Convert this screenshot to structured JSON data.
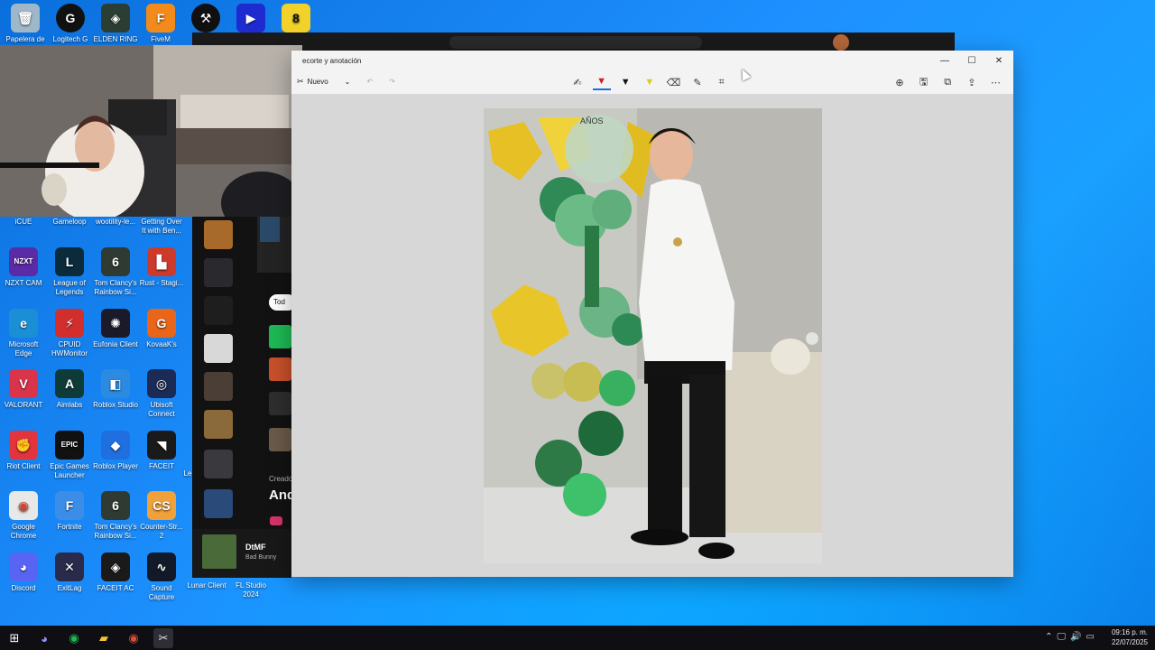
{
  "desktop": {
    "icons_top": [
      {
        "label": "Papelera de",
        "color": "#9fb8c9",
        "glyph": "🗑"
      },
      {
        "label": "Logitech G",
        "color": "#111111",
        "glyph": "G"
      },
      {
        "label": "ELDEN RING",
        "color": "#2a3e33",
        "glyph": "◈"
      },
      {
        "label": "FiveM",
        "color": "#f28a1c",
        "glyph": "F"
      },
      {
        "label": "",
        "color": "#101010",
        "glyph": "⚒"
      },
      {
        "label": "",
        "color": "#1d2bd1",
        "glyph": "▶"
      },
      {
        "label": "",
        "color": "#f2d22a",
        "glyph": "8"
      }
    ],
    "icons_col_labels_row1": [
      {
        "label": "iCUE"
      },
      {
        "label": "Gameloop"
      },
      {
        "label": "wootility-le..."
      },
      {
        "label": "Getting Over It with Ben..."
      }
    ],
    "grid": [
      {
        "label": "NZXT CAM",
        "color": "#5b2aa6",
        "glyph": "NZXT"
      },
      {
        "label": "League of Legends",
        "color": "#0b2a3a",
        "glyph": "L"
      },
      {
        "label": "Tom Clancy's Rainbow Si...",
        "color": "#2f3a33",
        "glyph": "6"
      },
      {
        "label": "Rust - Stagi...",
        "color": "#cd3a2b",
        "glyph": "▙"
      },
      {
        "label": "Microsoft Edge",
        "color": "#1b8fd6",
        "glyph": "e"
      },
      {
        "label": "CPUID HWMonitor",
        "color": "#d12e2e",
        "glyph": "⚡"
      },
      {
        "label": "Eufonia Client",
        "color": "#1a1a2a",
        "glyph": "✺"
      },
      {
        "label": "KovaaK's",
        "color": "#e8651a",
        "glyph": "G"
      },
      {
        "label": "VALORANT",
        "color": "#d9344a",
        "glyph": "V"
      },
      {
        "label": "Aimlabs",
        "color": "#0e3a38",
        "glyph": "A"
      },
      {
        "label": "Roblox Studio",
        "color": "#2a8be0",
        "glyph": "◧"
      },
      {
        "label": "Ubisoft Connect",
        "color": "#1c2a56",
        "glyph": "◎"
      },
      {
        "label": "Riot Client",
        "color": "#e2343f",
        "glyph": "✊"
      },
      {
        "label": "Epic Games Launcher",
        "color": "#111111",
        "glyph": "EPIC"
      },
      {
        "label": "Roblox Player",
        "color": "#1f6fe0",
        "glyph": "◆"
      },
      {
        "label": "FACEIT",
        "color": "#1a1a1a",
        "glyph": "◥"
      },
      {
        "label": "Google Chrome",
        "color": "#e8e8e8",
        "glyph": "◉"
      },
      {
        "label": "Fortnite",
        "color": "#3b8de8",
        "glyph": "F"
      },
      {
        "label": "Tom Clancy's Rainbow Si...",
        "color": "#2f3a33",
        "glyph": "6"
      },
      {
        "label": "Counter-Str... 2",
        "color": "#f0a13a",
        "glyph": "CS"
      },
      {
        "label": "Discord",
        "color": "#5865f2",
        "glyph": "◕"
      },
      {
        "label": "ExitLag",
        "color": "#2a2a4a",
        "glyph": "✕"
      },
      {
        "label": "FACEIT AC",
        "color": "#1a1a1a",
        "glyph": "◈"
      },
      {
        "label": "Sound Capture",
        "color": "#121a2a",
        "glyph": "∿"
      }
    ],
    "extra_labels": {
      "lunar": "Lunar Client",
      "flstudio": "FL Studio 2024",
      "le": "Le"
    }
  },
  "spotify": {
    "tab_label": "Tod",
    "created_by": "Creado",
    "artist_partial": "And",
    "now_playing": {
      "title": "DtMF",
      "artist": "Bad Bunny"
    }
  },
  "editor": {
    "title": "ecorte y anotación",
    "new_label": "Nuevo",
    "controls": {
      "minimize": "—",
      "maximize": "☐",
      "close": "✕"
    },
    "tools": [
      {
        "name": "touch-write-icon",
        "glyph": "✍"
      },
      {
        "name": "red-pen-icon",
        "glyph": "▼",
        "color": "#d21f1f",
        "active": true
      },
      {
        "name": "black-pen-icon",
        "glyph": "▼",
        "color": "#111111"
      },
      {
        "name": "highlighter-icon",
        "glyph": "▼",
        "color": "#d8cf1e"
      },
      {
        "name": "eraser-icon",
        "glyph": "⌫"
      },
      {
        "name": "ruler-icon",
        "glyph": "✎"
      },
      {
        "name": "crop-icon",
        "glyph": "⌗"
      }
    ],
    "right_tools": [
      {
        "name": "zoom-icon",
        "glyph": "⊕"
      },
      {
        "name": "save-icon",
        "glyph": "🖫"
      },
      {
        "name": "copy-icon",
        "glyph": "⧉"
      },
      {
        "name": "share-icon",
        "glyph": "⇪"
      },
      {
        "name": "more-icon",
        "glyph": "⋯"
      }
    ],
    "balloon_text": "AÑOS"
  },
  "taskbar": {
    "time": "09:16 p. m.",
    "date": "22/07/2025",
    "apps": [
      {
        "name": "start-icon",
        "glyph": "⊞",
        "color": "#ffffff"
      },
      {
        "name": "discord-icon",
        "glyph": "◕",
        "color": "#8a93ff"
      },
      {
        "name": "spotify-icon",
        "glyph": "◉",
        "color": "#1db954"
      },
      {
        "name": "file-explorer-icon",
        "glyph": "▰",
        "color": "#f2c23a"
      },
      {
        "name": "chrome-icon",
        "glyph": "◉",
        "color": "#e04a3a"
      },
      {
        "name": "snipping-tool-icon",
        "glyph": "✂",
        "color": "#e0e0e0"
      }
    ]
  }
}
